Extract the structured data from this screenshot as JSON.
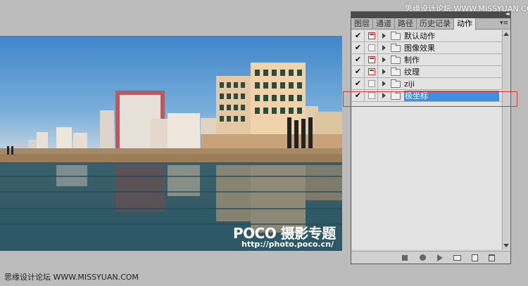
{
  "watermark": {
    "top": "思缘设计论坛 WWW.MISSYUAN.COM",
    "bottom": "思缘设计论坛 WWW.MISSYUAN.COM"
  },
  "photo": {
    "logo_text": "POCO 摄影专题",
    "url_text": "http://photo.poco.cn/"
  },
  "panel": {
    "tabs": [
      {
        "label": "图层",
        "active": false
      },
      {
        "label": "通道",
        "active": false
      },
      {
        "label": "路径",
        "active": false
      },
      {
        "label": "历史记录",
        "active": false
      },
      {
        "label": "动作",
        "active": true
      }
    ],
    "menu_icon": "panel-menu-icon",
    "actions": [
      {
        "label": "默认动作",
        "checked": true,
        "dialog": true,
        "selected": false
      },
      {
        "label": "图像效果",
        "checked": true,
        "dialog": false,
        "selected": false
      },
      {
        "label": "制作",
        "checked": true,
        "dialog": true,
        "selected": false
      },
      {
        "label": "纹理",
        "checked": true,
        "dialog": true,
        "selected": false
      },
      {
        "label": "ziji",
        "checked": true,
        "dialog": false,
        "selected": false
      },
      {
        "label": "极坐标",
        "checked": true,
        "dialog": false,
        "selected": true
      }
    ],
    "bottom_icons": [
      "stop-icon",
      "record-icon",
      "play-icon",
      "new-set-icon",
      "new-action-icon",
      "trash-icon"
    ]
  },
  "colors": {
    "selection": "#3d8fe0",
    "highlight_box": "#d23a3a",
    "background": "#bcbcbc"
  }
}
